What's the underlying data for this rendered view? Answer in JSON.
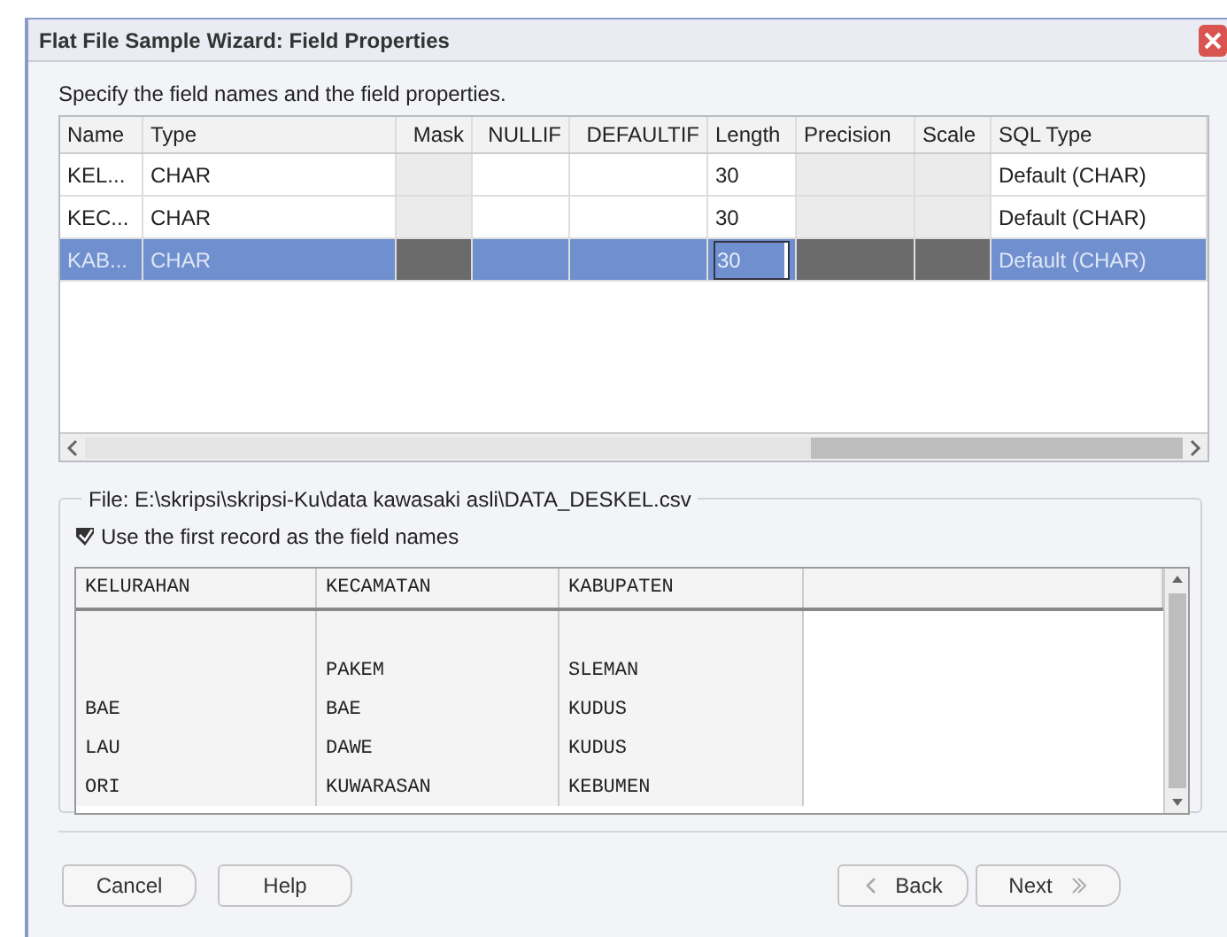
{
  "window": {
    "title": "Flat File Sample Wizard: Field Properties"
  },
  "instruction": "Specify the field names and the field properties.",
  "fields_table": {
    "columns": [
      {
        "label": "Name",
        "editable": true
      },
      {
        "label": "Type",
        "editable": true
      },
      {
        "label": "Mask",
        "editable": false
      },
      {
        "label": "NULLIF",
        "editable": true
      },
      {
        "label": "DEFAULTIF",
        "editable": true
      },
      {
        "label": "Length",
        "editable": true
      },
      {
        "label": "Precision",
        "editable": false
      },
      {
        "label": "Scale",
        "editable": false
      },
      {
        "label": "SQL Type",
        "editable": true
      }
    ],
    "rows": [
      {
        "name": "KEL...",
        "type": "CHAR",
        "length": "30",
        "sql_type": "Default (CHAR)",
        "selected": false,
        "editing": false
      },
      {
        "name": "KEC...",
        "type": "CHAR",
        "length": "30",
        "sql_type": "Default (CHAR)",
        "selected": false,
        "editing": false
      },
      {
        "name": "KAB...",
        "type": "CHAR",
        "length": "30",
        "sql_type": "Default (CHAR)",
        "selected": true,
        "editing": true
      }
    ]
  },
  "file_group": {
    "label": "File: E:\\skripsi\\skripsi-Ku\\data kawasaki asli\\DATA_DESKEL.csv",
    "use_first_record": {
      "label": "Use the first record as the field names",
      "checked": true
    },
    "preview": {
      "columns": [
        "KELURAHAN",
        "KECAMATAN",
        "KABUPATEN"
      ],
      "rows": [
        [
          null,
          null,
          null
        ],
        [
          null,
          "PAKEM",
          "SLEMAN"
        ],
        [
          "BAE",
          "BAE",
          "KUDUS"
        ],
        [
          "LAU",
          "DAWE",
          "KUDUS"
        ],
        [
          "ORI",
          "KUWARASAN",
          "KEBUMEN"
        ]
      ]
    }
  },
  "buttons": [
    {
      "label": "Cancel",
      "kind": "plain"
    },
    {
      "label": "Help",
      "kind": "plain"
    },
    {
      "label": "Back",
      "kind": "back"
    },
    {
      "label": "Next",
      "kind": "next"
    }
  ]
}
